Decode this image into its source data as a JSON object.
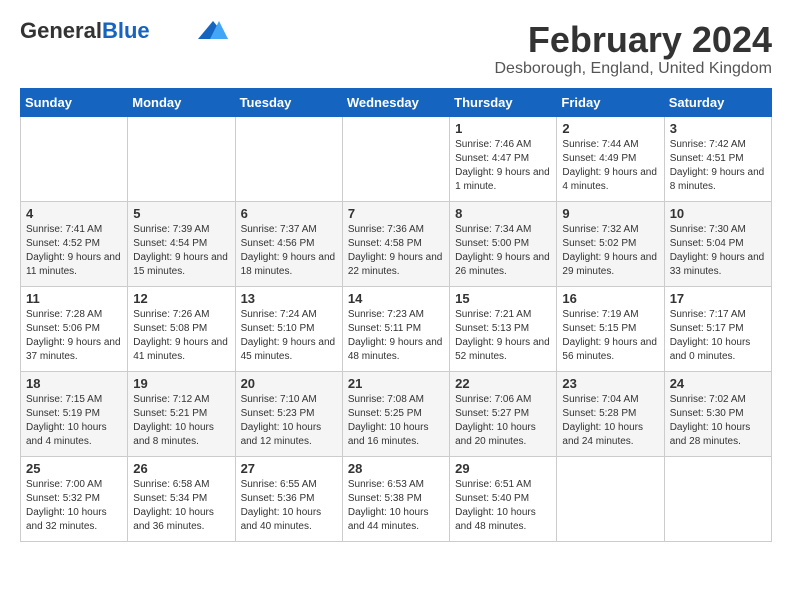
{
  "header": {
    "logo_general": "General",
    "logo_blue": "Blue",
    "month_title": "February 2024",
    "location": "Desborough, England, United Kingdom"
  },
  "days_of_week": [
    "Sunday",
    "Monday",
    "Tuesday",
    "Wednesday",
    "Thursday",
    "Friday",
    "Saturday"
  ],
  "weeks": [
    [
      {
        "day": "",
        "sunrise": "",
        "sunset": "",
        "daylight": ""
      },
      {
        "day": "",
        "sunrise": "",
        "sunset": "",
        "daylight": ""
      },
      {
        "day": "",
        "sunrise": "",
        "sunset": "",
        "daylight": ""
      },
      {
        "day": "",
        "sunrise": "",
        "sunset": "",
        "daylight": ""
      },
      {
        "day": "1",
        "sunrise": "Sunrise: 7:46 AM",
        "sunset": "Sunset: 4:47 PM",
        "daylight": "Daylight: 9 hours and 1 minute."
      },
      {
        "day": "2",
        "sunrise": "Sunrise: 7:44 AM",
        "sunset": "Sunset: 4:49 PM",
        "daylight": "Daylight: 9 hours and 4 minutes."
      },
      {
        "day": "3",
        "sunrise": "Sunrise: 7:42 AM",
        "sunset": "Sunset: 4:51 PM",
        "daylight": "Daylight: 9 hours and 8 minutes."
      }
    ],
    [
      {
        "day": "4",
        "sunrise": "Sunrise: 7:41 AM",
        "sunset": "Sunset: 4:52 PM",
        "daylight": "Daylight: 9 hours and 11 minutes."
      },
      {
        "day": "5",
        "sunrise": "Sunrise: 7:39 AM",
        "sunset": "Sunset: 4:54 PM",
        "daylight": "Daylight: 9 hours and 15 minutes."
      },
      {
        "day": "6",
        "sunrise": "Sunrise: 7:37 AM",
        "sunset": "Sunset: 4:56 PM",
        "daylight": "Daylight: 9 hours and 18 minutes."
      },
      {
        "day": "7",
        "sunrise": "Sunrise: 7:36 AM",
        "sunset": "Sunset: 4:58 PM",
        "daylight": "Daylight: 9 hours and 22 minutes."
      },
      {
        "day": "8",
        "sunrise": "Sunrise: 7:34 AM",
        "sunset": "Sunset: 5:00 PM",
        "daylight": "Daylight: 9 hours and 26 minutes."
      },
      {
        "day": "9",
        "sunrise": "Sunrise: 7:32 AM",
        "sunset": "Sunset: 5:02 PM",
        "daylight": "Daylight: 9 hours and 29 minutes."
      },
      {
        "day": "10",
        "sunrise": "Sunrise: 7:30 AM",
        "sunset": "Sunset: 5:04 PM",
        "daylight": "Daylight: 9 hours and 33 minutes."
      }
    ],
    [
      {
        "day": "11",
        "sunrise": "Sunrise: 7:28 AM",
        "sunset": "Sunset: 5:06 PM",
        "daylight": "Daylight: 9 hours and 37 minutes."
      },
      {
        "day": "12",
        "sunrise": "Sunrise: 7:26 AM",
        "sunset": "Sunset: 5:08 PM",
        "daylight": "Daylight: 9 hours and 41 minutes."
      },
      {
        "day": "13",
        "sunrise": "Sunrise: 7:24 AM",
        "sunset": "Sunset: 5:10 PM",
        "daylight": "Daylight: 9 hours and 45 minutes."
      },
      {
        "day": "14",
        "sunrise": "Sunrise: 7:23 AM",
        "sunset": "Sunset: 5:11 PM",
        "daylight": "Daylight: 9 hours and 48 minutes."
      },
      {
        "day": "15",
        "sunrise": "Sunrise: 7:21 AM",
        "sunset": "Sunset: 5:13 PM",
        "daylight": "Daylight: 9 hours and 52 minutes."
      },
      {
        "day": "16",
        "sunrise": "Sunrise: 7:19 AM",
        "sunset": "Sunset: 5:15 PM",
        "daylight": "Daylight: 9 hours and 56 minutes."
      },
      {
        "day": "17",
        "sunrise": "Sunrise: 7:17 AM",
        "sunset": "Sunset: 5:17 PM",
        "daylight": "Daylight: 10 hours and 0 minutes."
      }
    ],
    [
      {
        "day": "18",
        "sunrise": "Sunrise: 7:15 AM",
        "sunset": "Sunset: 5:19 PM",
        "daylight": "Daylight: 10 hours and 4 minutes."
      },
      {
        "day": "19",
        "sunrise": "Sunrise: 7:12 AM",
        "sunset": "Sunset: 5:21 PM",
        "daylight": "Daylight: 10 hours and 8 minutes."
      },
      {
        "day": "20",
        "sunrise": "Sunrise: 7:10 AM",
        "sunset": "Sunset: 5:23 PM",
        "daylight": "Daylight: 10 hours and 12 minutes."
      },
      {
        "day": "21",
        "sunrise": "Sunrise: 7:08 AM",
        "sunset": "Sunset: 5:25 PM",
        "daylight": "Daylight: 10 hours and 16 minutes."
      },
      {
        "day": "22",
        "sunrise": "Sunrise: 7:06 AM",
        "sunset": "Sunset: 5:27 PM",
        "daylight": "Daylight: 10 hours and 20 minutes."
      },
      {
        "day": "23",
        "sunrise": "Sunrise: 7:04 AM",
        "sunset": "Sunset: 5:28 PM",
        "daylight": "Daylight: 10 hours and 24 minutes."
      },
      {
        "day": "24",
        "sunrise": "Sunrise: 7:02 AM",
        "sunset": "Sunset: 5:30 PM",
        "daylight": "Daylight: 10 hours and 28 minutes."
      }
    ],
    [
      {
        "day": "25",
        "sunrise": "Sunrise: 7:00 AM",
        "sunset": "Sunset: 5:32 PM",
        "daylight": "Daylight: 10 hours and 32 minutes."
      },
      {
        "day": "26",
        "sunrise": "Sunrise: 6:58 AM",
        "sunset": "Sunset: 5:34 PM",
        "daylight": "Daylight: 10 hours and 36 minutes."
      },
      {
        "day": "27",
        "sunrise": "Sunrise: 6:55 AM",
        "sunset": "Sunset: 5:36 PM",
        "daylight": "Daylight: 10 hours and 40 minutes."
      },
      {
        "day": "28",
        "sunrise": "Sunrise: 6:53 AM",
        "sunset": "Sunset: 5:38 PM",
        "daylight": "Daylight: 10 hours and 44 minutes."
      },
      {
        "day": "29",
        "sunrise": "Sunrise: 6:51 AM",
        "sunset": "Sunset: 5:40 PM",
        "daylight": "Daylight: 10 hours and 48 minutes."
      },
      {
        "day": "",
        "sunrise": "",
        "sunset": "",
        "daylight": ""
      },
      {
        "day": "",
        "sunrise": "",
        "sunset": "",
        "daylight": ""
      }
    ]
  ]
}
